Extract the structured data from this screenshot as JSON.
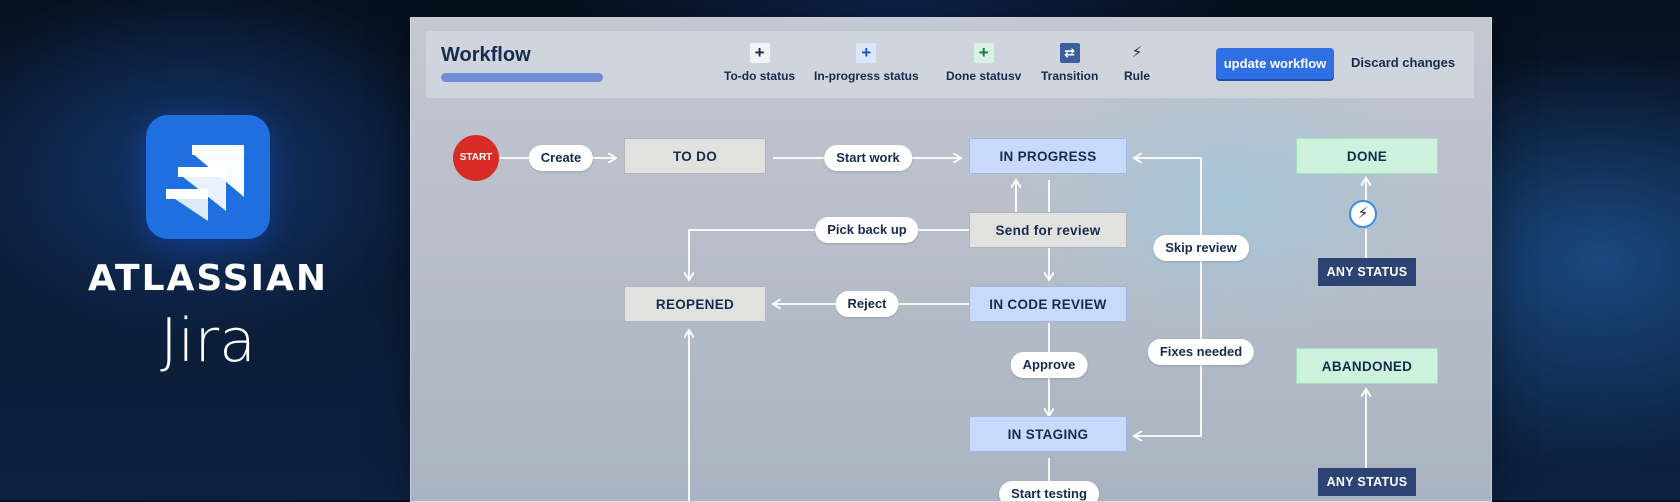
{
  "brand": {
    "company": "ATLASSIAN",
    "product": "Jira",
    "logo_icon": "jira-logo-icon",
    "logo_color": "#1f6fe0"
  },
  "toolbar": {
    "title": "Workflow",
    "tools": [
      {
        "label": "To-do status",
        "icon": "plus-icon",
        "glyph": "+"
      },
      {
        "label": "In-progress status",
        "icon": "plus-icon",
        "glyph": "+"
      },
      {
        "label": "Done statusv",
        "icon": "plus-icon",
        "glyph": "+"
      },
      {
        "label": "Transition",
        "icon": "transition-icon",
        "glyph": "⇄"
      },
      {
        "label": "Rule",
        "icon": "lightning-icon",
        "glyph": "⚡"
      }
    ],
    "update_label": "update workflow",
    "discard_label": "Discard changes",
    "accent": "#2f6fe4"
  },
  "flow": {
    "start_label": "START",
    "statuses": {
      "todo": "TO DO",
      "in_progress": "IN PROGRESS",
      "done": "DONE",
      "reopened": "REOPENED",
      "code_review": "IN CODE REVIEW",
      "staging": "IN STAGING",
      "abandoned": "ABANDONED",
      "send_for_review": "Send for review",
      "any_status_1": "ANY STATUS",
      "any_status_2": "ANY STATUS"
    },
    "transitions": {
      "create": "Create",
      "start_work": "Start work",
      "pick_back_up": "Pick back up",
      "skip_review": "Skip review",
      "reject": "Reject",
      "fixes_needed": "Fixes needed",
      "approve": "Approve",
      "start_testing": "Start testing"
    },
    "colors": {
      "start": "#d92b25",
      "gray_status": "#e1e2df",
      "blue_status": "#c9d9fb",
      "green_status": "#cdf3df",
      "any_status": "#2c4374"
    }
  }
}
